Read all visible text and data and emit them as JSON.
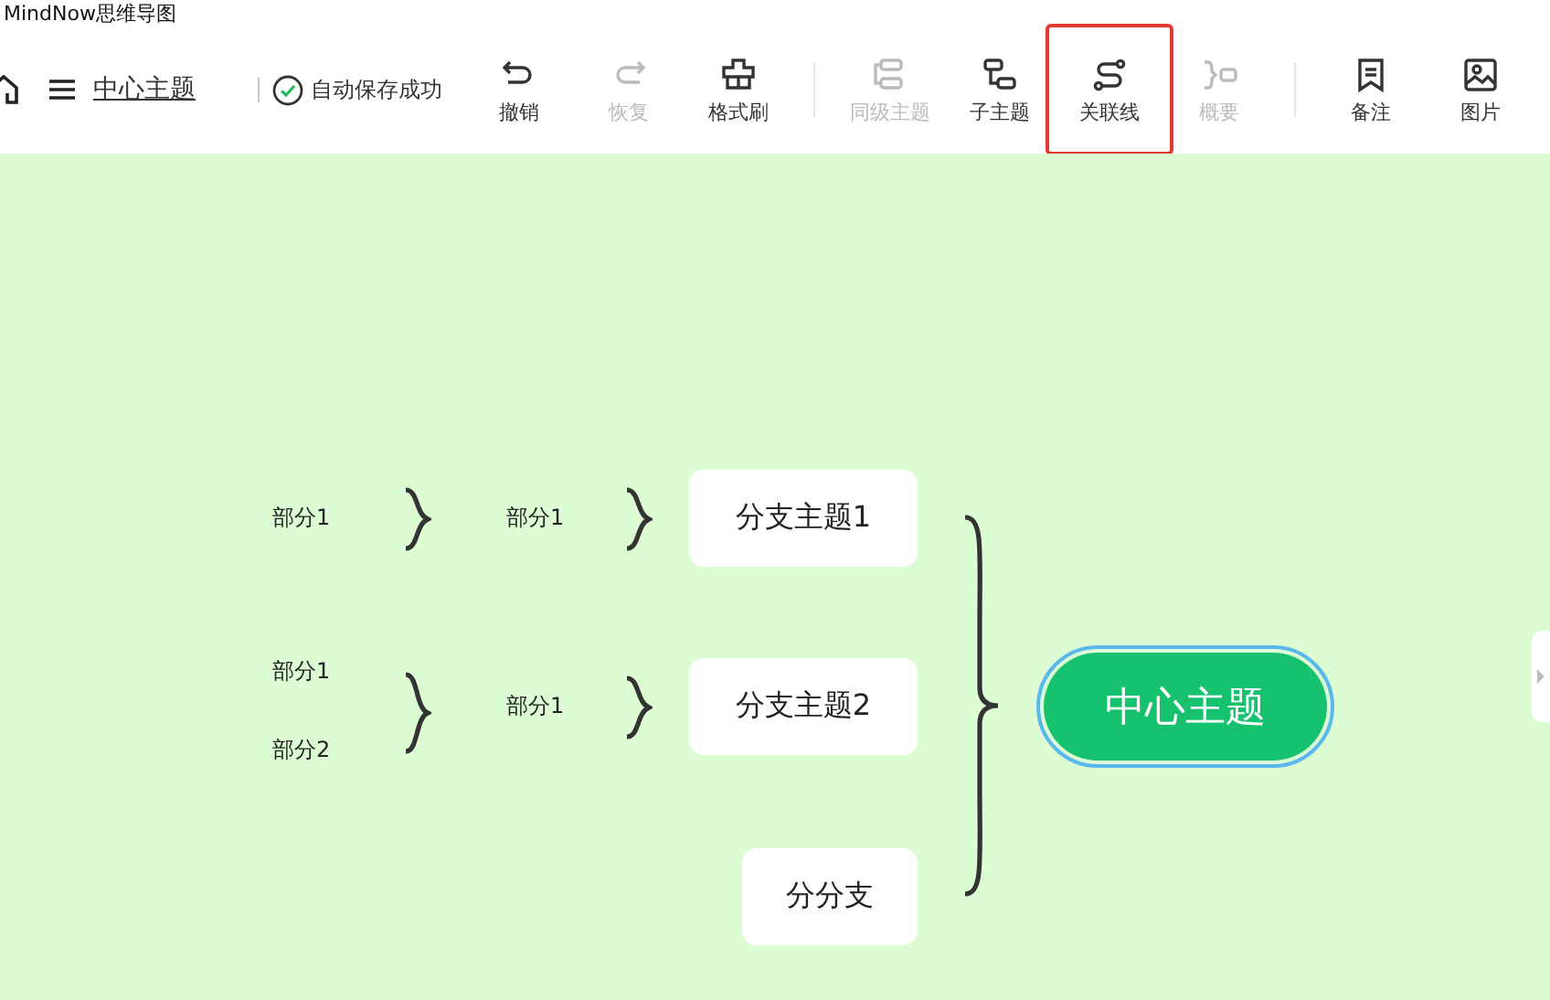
{
  "window": {
    "title": "MindNow思维导图"
  },
  "toolbar": {
    "document_title": "中心主题",
    "save_status": "自动保存成功",
    "buttons": [
      {
        "kind": "undo",
        "label": "撤销",
        "disabled": false,
        "highlighted": false
      },
      {
        "kind": "redo",
        "label": "恢复",
        "disabled": true,
        "highlighted": false
      },
      {
        "kind": "format-painter",
        "label": "格式刷",
        "disabled": false,
        "highlighted": false
      },
      {
        "kind": "divider"
      },
      {
        "kind": "sibling",
        "label": "同级主题",
        "disabled": true,
        "highlighted": false
      },
      {
        "kind": "child",
        "label": "子主题",
        "disabled": false,
        "highlighted": false
      },
      {
        "kind": "relation",
        "label": "关联线",
        "disabled": false,
        "highlighted": true
      },
      {
        "kind": "summary",
        "label": "概要",
        "disabled": true,
        "highlighted": false
      },
      {
        "kind": "divider"
      },
      {
        "kind": "note",
        "label": "备注",
        "disabled": false,
        "highlighted": false
      },
      {
        "kind": "image",
        "label": "图片",
        "disabled": false,
        "highlighted": false
      }
    ]
  },
  "mindmap": {
    "center": {
      "text": "中心主题",
      "selected": true
    },
    "branches": [
      {
        "text": "分支主题1",
        "summaries": [
          {
            "items": [
              "部分1"
            ]
          },
          {
            "items": [
              "部分1"
            ]
          }
        ]
      },
      {
        "text": "分支主题2",
        "summaries": [
          {
            "items": [
              "部分1",
              "部分2"
            ]
          },
          {
            "items": [
              "部分1"
            ]
          }
        ]
      },
      {
        "text": "分分支"
      }
    ]
  }
}
